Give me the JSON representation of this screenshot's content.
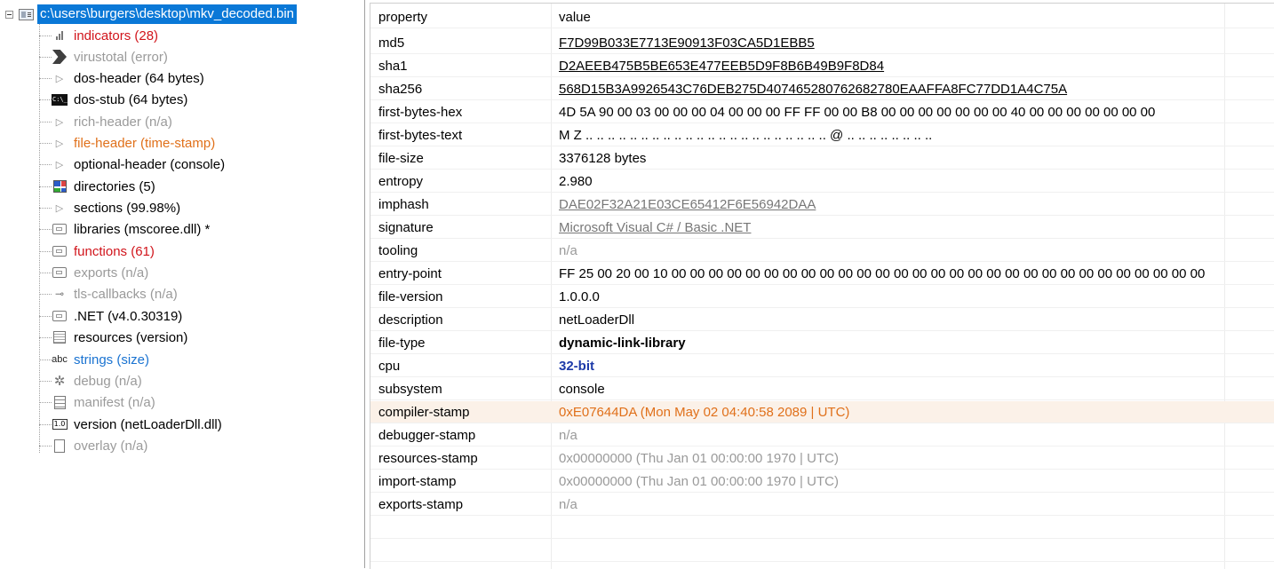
{
  "tree": {
    "root_label": "c:\\users\\burgers\\desktop\\mkv_decoded.bin",
    "items": [
      {
        "label": "indicators (28)",
        "color": "red",
        "icon": "bar-chart-icon"
      },
      {
        "label": "virustotal (error)",
        "color": "gray",
        "icon": "virustotal-icon"
      },
      {
        "label": "dos-header (64 bytes)",
        "color": "black",
        "icon": "triangle-icon"
      },
      {
        "label": "dos-stub (64 bytes)",
        "color": "black",
        "icon": "console-icon"
      },
      {
        "label": "rich-header (n/a)",
        "color": "gray",
        "icon": "triangle-icon"
      },
      {
        "label": "file-header (time-stamp)",
        "color": "orange",
        "icon": "triangle-icon"
      },
      {
        "label": "optional-header (console)",
        "color": "black",
        "icon": "triangle-icon"
      },
      {
        "label": "directories (5)",
        "color": "black",
        "icon": "grid-icon"
      },
      {
        "label": "sections (99.98%)",
        "color": "black",
        "icon": "triangle-icon"
      },
      {
        "label": "libraries (mscoree.dll) *",
        "color": "black",
        "icon": "library-icon"
      },
      {
        "label": "functions (61)",
        "color": "red",
        "icon": "function-icon"
      },
      {
        "label": "exports (n/a)",
        "color": "gray",
        "icon": "export-icon"
      },
      {
        "label": "tls-callbacks (n/a)",
        "color": "gray",
        "icon": "key-icon"
      },
      {
        "label": ".NET (v4.0.30319)",
        "color": "black",
        "icon": "dotnet-icon"
      },
      {
        "label": "resources (version)",
        "color": "black",
        "icon": "resources-icon"
      },
      {
        "label": "strings (size)",
        "color": "blue",
        "icon": "abc-icon"
      },
      {
        "label": "debug (n/a)",
        "color": "gray",
        "icon": "bug-icon"
      },
      {
        "label": "manifest (n/a)",
        "color": "gray",
        "icon": "manifest-icon"
      },
      {
        "label": "version (netLoaderDll.dll)",
        "color": "black",
        "icon": "version-icon"
      },
      {
        "label": "overlay (n/a)",
        "color": "gray",
        "icon": "page-icon"
      }
    ]
  },
  "table": {
    "header": {
      "property": "property",
      "value": "value"
    },
    "rows": [
      {
        "property": "md5",
        "value": "F7D99B033E7713E90913F03CA5D1EBB5",
        "style": "link"
      },
      {
        "property": "sha1",
        "value": "D2AEEB475B5BE653E477EEB5D9F8B6B49B9F8D84",
        "style": "link"
      },
      {
        "property": "sha256",
        "value": "568D15B3A9926543C76DEB275D40746528076268278 0EAAFFA8FC77DD1A4C75A",
        "style": "link"
      },
      {
        "property": "first-bytes-hex",
        "value": "4D 5A 90 00 03 00 00 00 04 00 00 00 FF FF 00 00 B8 00 00 00 00 00 00 00 40 00 00 00 00 00 00 00",
        "style": "plain"
      },
      {
        "property": "first-bytes-text",
        "value": "M Z .. .. .. .. .. .. .. .. .. .. .. .. .. .. .. .. .. .. .. .. .. .. @ .. .. .. .. .. .. .. ..",
        "style": "plain"
      },
      {
        "property": "file-size",
        "value": "3376128 bytes",
        "style": "plain"
      },
      {
        "property": "entropy",
        "value": "2.980",
        "style": "plain"
      },
      {
        "property": "imphash",
        "value": "DAE02F32A21E03CE65412F6E56942DAA",
        "style": "graylink"
      },
      {
        "property": "signature",
        "value": "Microsoft Visual C# / Basic .NET",
        "style": "graylink"
      },
      {
        "property": "tooling",
        "value": "n/a",
        "style": "gray"
      },
      {
        "property": "entry-point",
        "value": "FF 25 00 20 00 10 00 00 00 00 00 00 00 00 00 00 00 00 00 00 00 00 00 00 00 00 00 00 00 00 00 00 00 00 00",
        "style": "plain"
      },
      {
        "property": "file-version",
        "value": "1.0.0.0",
        "style": "plain"
      },
      {
        "property": "description",
        "value": "netLoaderDll",
        "style": "plain"
      },
      {
        "property": "file-type",
        "value": "dynamic-link-library",
        "style": "bold"
      },
      {
        "property": "cpu",
        "value": "32-bit",
        "style": "bluebold"
      },
      {
        "property": "subsystem",
        "value": "console",
        "style": "plain"
      },
      {
        "property": "compiler-stamp",
        "value": "0xE07644DA (Mon May 02 04:40:58 2089 | UTC)",
        "style": "orange"
      },
      {
        "property": "debugger-stamp",
        "value": "n/a",
        "style": "gray"
      },
      {
        "property": "resources-stamp",
        "value": "0x00000000 (Thu Jan 01 00:00:00 1970 | UTC)",
        "style": "gray"
      },
      {
        "property": "import-stamp",
        "value": "0x00000000 (Thu Jan 01 00:00:00 1970 | UTC)",
        "style": "gray"
      },
      {
        "property": "exports-stamp",
        "value": "n/a",
        "style": "gray"
      }
    ]
  }
}
